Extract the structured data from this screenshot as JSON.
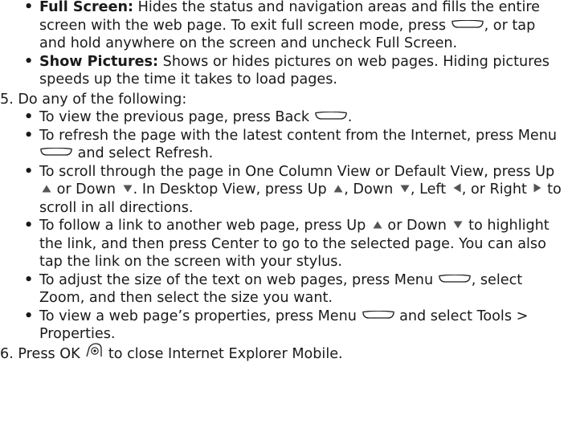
{
  "items": {
    "full_screen": {
      "term": "Full Screen:",
      "text_a": " Hides the status and navigation areas and fills the entire screen with the web page. To exit full screen mode, press ",
      "text_b": ", or tap and hold anywhere on the screen and uncheck Full Screen."
    },
    "show_pictures": {
      "term": "Show Pictures:",
      "text": " Shows or hides pictures on web pages. Hiding pictures speeds up the time it takes to load pages."
    }
  },
  "step5": {
    "heading": "5. Do any of the following:",
    "b1": {
      "a": "To view the previous page, press Back ",
      "b": "."
    },
    "b2": {
      "a": "To refresh the page with the latest content from the Internet, press Menu ",
      "b": " and select Refresh."
    },
    "b3": {
      "a": "To scroll through the page in One Column View or Default View, press Up ",
      "b": " or Down ",
      "c": ". In Desktop View, press Up ",
      "d": ", Down ",
      "e": ", Left ",
      "f": ", or Right ",
      "g": " to scroll in all directions."
    },
    "b4": {
      "a": "To follow a link to another web page, press Up ",
      "b": " or Down ",
      "c": " to highlight the link, and then press Center to go to the selected page. You can also tap the link on the screen with your stylus."
    },
    "b5": {
      "a": "To adjust the size of the text on web pages, press Menu ",
      "b": ", select Zoom, and then select the size you want."
    },
    "b6": {
      "a": "To view a web page’s properties, press Menu ",
      "b": " and select Tools > Properties."
    }
  },
  "step6": {
    "a": "6. Press OK ",
    "b": " to close Internet Explorer Mobile."
  },
  "icons": [
    "softkey-icon",
    "arrow-up-icon",
    "arrow-down-icon",
    "arrow-left-icon",
    "arrow-right-icon",
    "ok-button-icon"
  ],
  "colors": {
    "text": "#1a1a1a",
    "icon_fill": "#555555"
  }
}
